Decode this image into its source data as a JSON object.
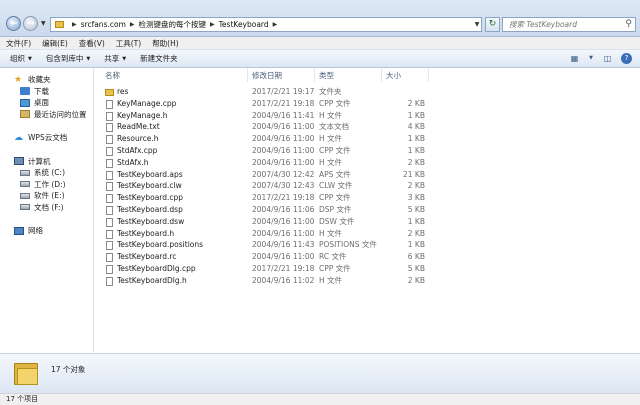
{
  "address": {
    "crumbs": [
      "srcfans.com",
      "检测键盘的每个按键",
      "TestKeyboard"
    ],
    "search_placeholder": "搜索 TestKeyboard"
  },
  "menu": [
    "文件(F)",
    "编辑(E)",
    "查看(V)",
    "工具(T)",
    "帮助(H)"
  ],
  "toolbar": {
    "organize": "组织",
    "include_in_library": "包含到库中",
    "share": "共享",
    "new_folder": "新建文件夹"
  },
  "nav": {
    "favorites": "收藏夹",
    "downloads": "下载",
    "desktop": "桌面",
    "recent": "最近访问的位置",
    "wps_cloud": "WPS云文档",
    "computer": "计算机",
    "drives": [
      "系统 (C:)",
      "工作 (D:)",
      "软件 (E:)",
      "文档 (F:)"
    ],
    "network": "网络"
  },
  "columns": {
    "name": "名称",
    "date": "修改日期",
    "type": "类型",
    "size": "大小"
  },
  "files": [
    {
      "name": "res",
      "date": "2017/2/21 19:17",
      "type": "文件夹",
      "size": "",
      "folder": true
    },
    {
      "name": "KeyManage.cpp",
      "date": "2017/2/21 19:18",
      "type": "CPP 文件",
      "size": "2 KB"
    },
    {
      "name": "KeyManage.h",
      "date": "2004/9/16 11:41",
      "type": "H 文件",
      "size": "1 KB"
    },
    {
      "name": "ReadMe.txt",
      "date": "2004/9/16 11:00",
      "type": "文本文档",
      "size": "4 KB"
    },
    {
      "name": "Resource.h",
      "date": "2004/9/16 11:00",
      "type": "H 文件",
      "size": "1 KB"
    },
    {
      "name": "StdAfx.cpp",
      "date": "2004/9/16 11:00",
      "type": "CPP 文件",
      "size": "1 KB"
    },
    {
      "name": "StdAfx.h",
      "date": "2004/9/16 11:00",
      "type": "H 文件",
      "size": "2 KB"
    },
    {
      "name": "TestKeyboard.aps",
      "date": "2007/4/30 12:42",
      "type": "APS 文件",
      "size": "21 KB"
    },
    {
      "name": "TestKeyboard.clw",
      "date": "2007/4/30 12:43",
      "type": "CLW 文件",
      "size": "2 KB"
    },
    {
      "name": "TestKeyboard.cpp",
      "date": "2017/2/21 19:18",
      "type": "CPP 文件",
      "size": "3 KB"
    },
    {
      "name": "TestKeyboard.dsp",
      "date": "2004/9/16 11:06",
      "type": "DSP 文件",
      "size": "5 KB"
    },
    {
      "name": "TestKeyboard.dsw",
      "date": "2004/9/16 11:00",
      "type": "DSW 文件",
      "size": "1 KB"
    },
    {
      "name": "TestKeyboard.h",
      "date": "2004/9/16 11:00",
      "type": "H 文件",
      "size": "2 KB"
    },
    {
      "name": "TestKeyboard.positions",
      "date": "2004/9/16 11:43",
      "type": "POSITIONS 文件",
      "size": "1 KB"
    },
    {
      "name": "TestKeyboard.rc",
      "date": "2004/9/16 11:00",
      "type": "RC 文件",
      "size": "6 KB"
    },
    {
      "name": "TestKeyboardDlg.cpp",
      "date": "2017/2/21 19:18",
      "type": "CPP 文件",
      "size": "5 KB"
    },
    {
      "name": "TestKeyboardDlg.h",
      "date": "2004/9/16 11:02",
      "type": "H 文件",
      "size": "2 KB"
    }
  ],
  "details": {
    "count_text": "17 个对象"
  },
  "status": {
    "text": "17 个项目"
  },
  "icons": {
    "back": "back-arrow-icon",
    "forward": "forward-arrow-icon",
    "refresh": "refresh-icon",
    "search": "search-icon"
  }
}
